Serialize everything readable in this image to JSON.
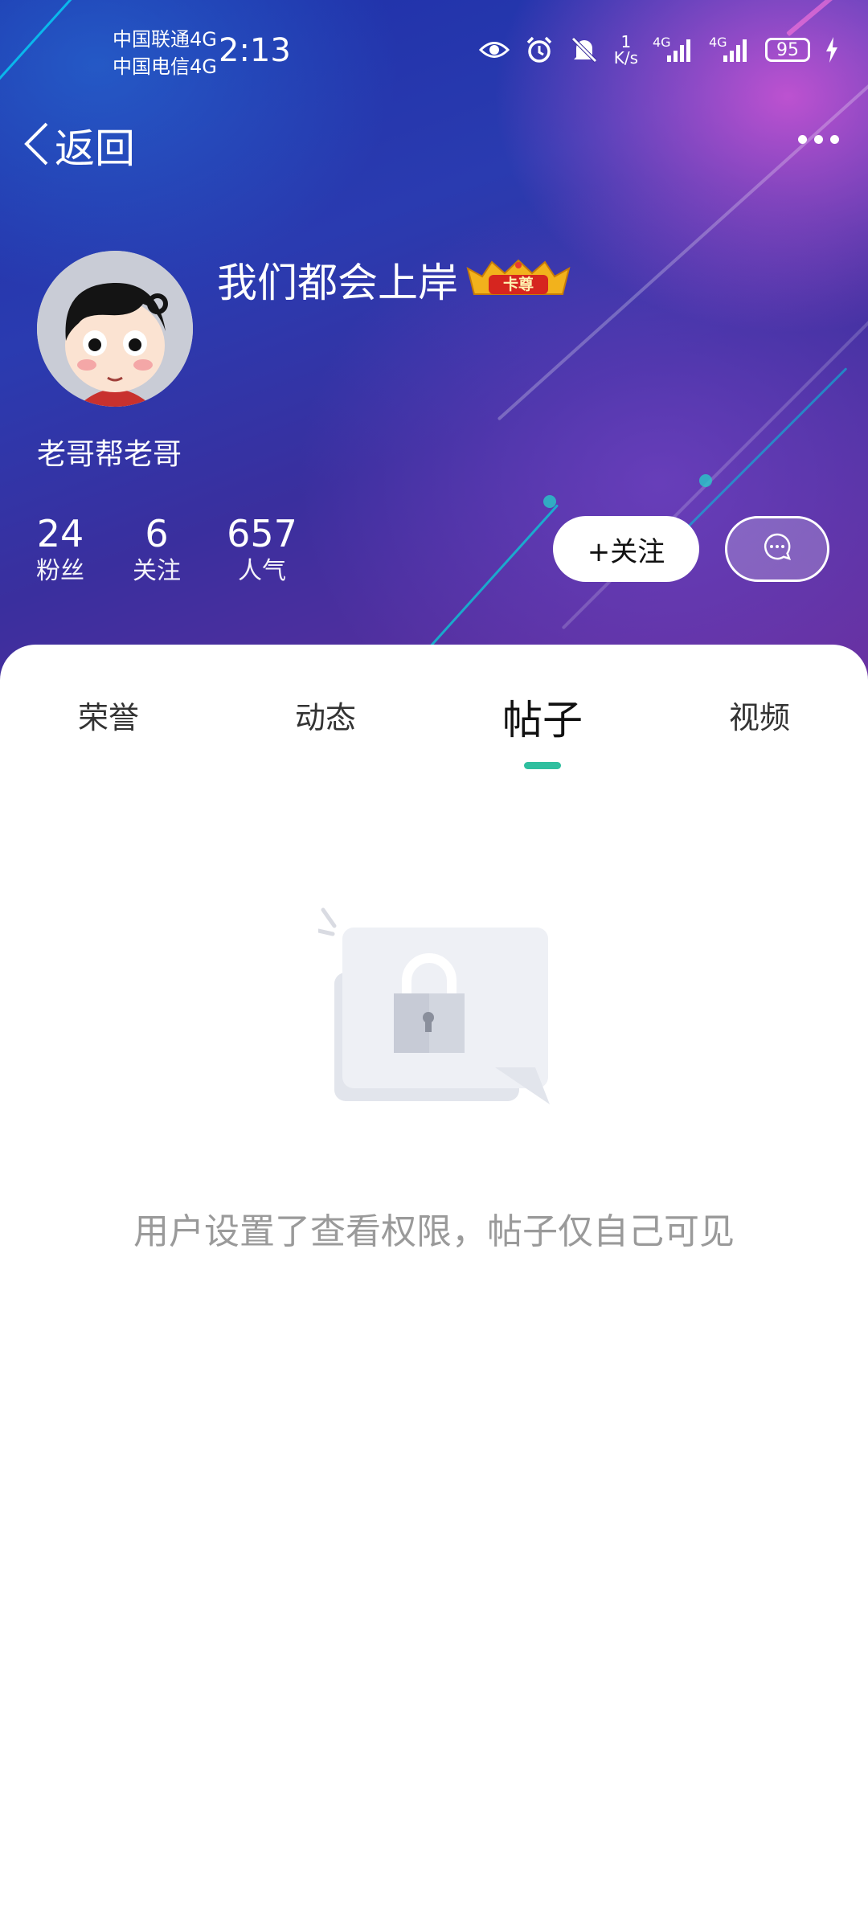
{
  "status_bar": {
    "carrier_1": "中国联通4G",
    "carrier_2": "中国电信4G",
    "time": "2:13",
    "speed_value": "1",
    "speed_unit": "K/s",
    "net_1": "4G",
    "net_2": "4G",
    "battery": "95"
  },
  "header": {
    "back_label": "返回"
  },
  "profile": {
    "username": "我们都会上岸",
    "badge_text": "卡尊",
    "subname": "老哥帮老哥",
    "stats": [
      {
        "value": "24",
        "label": "粉丝"
      },
      {
        "value": "6",
        "label": "关注"
      },
      {
        "value": "657",
        "label": "人气"
      }
    ],
    "follow_label": "+关注"
  },
  "tabs": [
    {
      "label": "荣誉",
      "active": false
    },
    {
      "label": "动态",
      "active": false
    },
    {
      "label": "帖子",
      "active": true
    },
    {
      "label": "视频",
      "active": false
    }
  ],
  "empty_state": {
    "message": "用户设置了查看权限，帖子仅自己可见"
  },
  "colors": {
    "accent": "#2fbf9f",
    "hero_start": "#1d2fa8",
    "hero_end": "#6a2f9e"
  }
}
